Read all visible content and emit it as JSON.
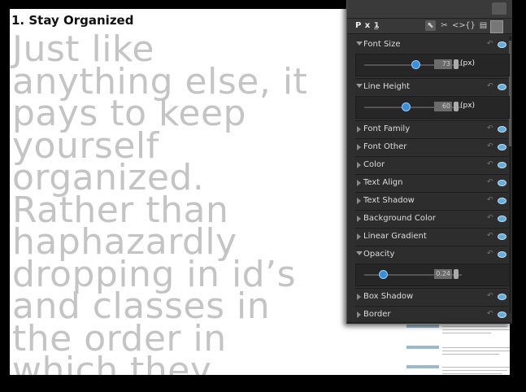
{
  "document": {
    "heading": "1. Stay Organized",
    "body_text": "Just like\nanything else, it\npays to keep\nyourself\norganized.\nRather than\nhaphazardly\ndropping in id’s\nand classes in\nthe order in\nwhich they"
  },
  "panel": {
    "brand": "P x 1",
    "help": "?",
    "toolbar_icons": [
      "inspect-icon",
      "link-icon",
      "code-icon",
      "braces-icon",
      "comment-icon",
      "color-swatch-icon"
    ],
    "properties": [
      {
        "label": "Font Size",
        "expanded": true,
        "value": "73",
        "unit": "(px)",
        "slider_fraction": 0.52
      },
      {
        "label": "Line Height",
        "expanded": true,
        "value": "60",
        "unit": "(px)",
        "slider_fraction": 0.42
      },
      {
        "label": "Font Family",
        "expanded": false
      },
      {
        "label": "Font Other",
        "expanded": false
      },
      {
        "label": "Color",
        "expanded": false
      },
      {
        "label": "Text Align",
        "expanded": false
      },
      {
        "label": "Text Shadow",
        "expanded": false
      },
      {
        "label": "Background Color",
        "expanded": false
      },
      {
        "label": "Linear Gradient",
        "expanded": false
      },
      {
        "label": "Opacity",
        "expanded": true,
        "value": "0.24",
        "unit": "",
        "slider_fraction": 0.18
      },
      {
        "label": "Box Shadow",
        "expanded": false
      },
      {
        "label": "Border",
        "expanded": false
      }
    ]
  },
  "colors": {
    "panel_bg": "#2f2f2f",
    "accent_blue": "#3b8fd6",
    "body_text": "#c4c4c4"
  }
}
